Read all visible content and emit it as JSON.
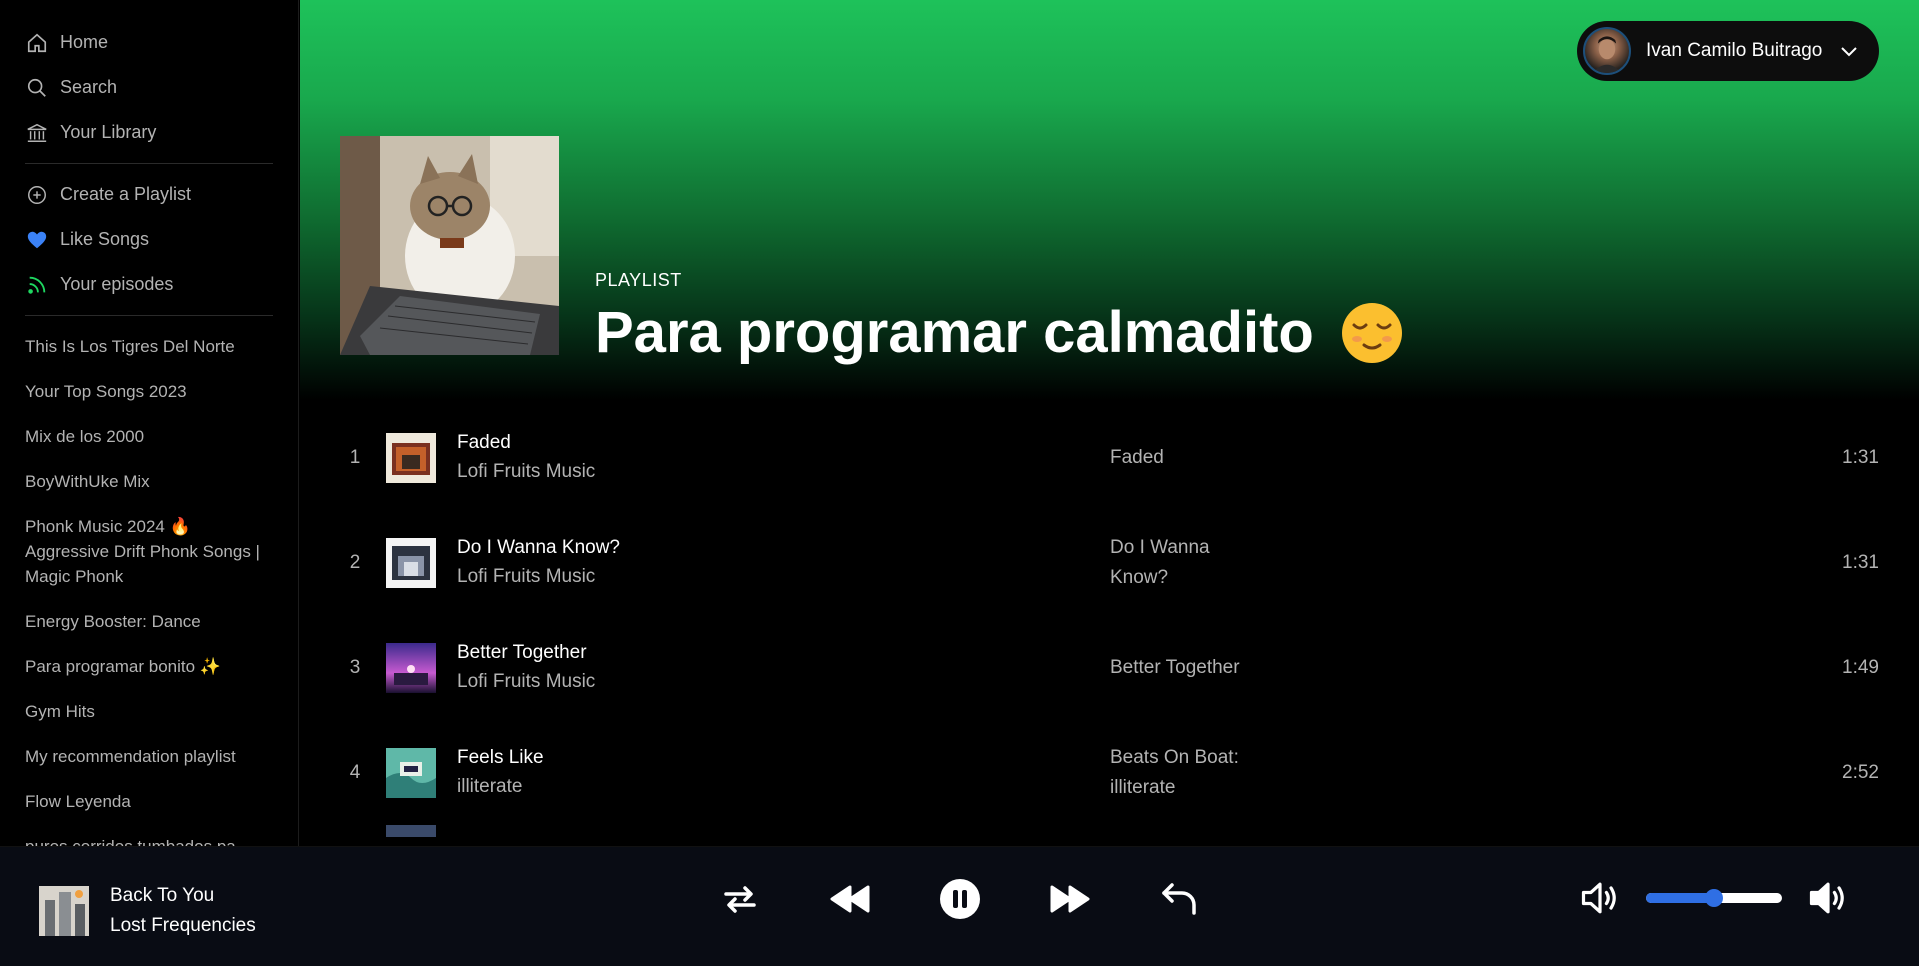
{
  "sidebar": {
    "nav": [
      {
        "label": "Home",
        "icon": "home-icon"
      },
      {
        "label": "Search",
        "icon": "search-icon"
      },
      {
        "label": "Your Library",
        "icon": "library-icon"
      }
    ],
    "actions": [
      {
        "label": "Create a Playlist",
        "icon": "plus-circle-icon"
      },
      {
        "label": "Like Songs",
        "icon": "heart-icon"
      },
      {
        "label": "Your episodes",
        "icon": "rss-icon"
      }
    ],
    "playlists": [
      "This Is Los Tigres Del Norte",
      "Your Top Songs 2023",
      "Mix de los 2000",
      "BoyWithUke Mix",
      "Phonk Music 2024 🔥 Aggressive Drift Phonk Songs | Magic Phonk",
      "Energy Booster: Dance",
      "Para programar bonito ✨",
      "Gym Hits",
      "My recommendation playlist",
      "Flow Leyenda",
      "puros corridos tumbados pa"
    ]
  },
  "user": {
    "name": "Ivan Camilo Buitrago"
  },
  "playlist": {
    "type": "PLAYLIST",
    "title": "Para programar calmadito",
    "title_emoji": "😌"
  },
  "tracks": [
    {
      "num": "1",
      "title": "Faded",
      "artist": "Lofi Fruits Music",
      "album": "Faded",
      "duration": "1:31"
    },
    {
      "num": "2",
      "title": "Do I Wanna Know?",
      "artist": "Lofi Fruits Music",
      "album": "Do I Wanna Know?",
      "duration": "1:31"
    },
    {
      "num": "3",
      "title": "Better Together",
      "artist": "Lofi Fruits Music",
      "album": "Better Together",
      "duration": "1:49"
    },
    {
      "num": "4",
      "title": "Feels Like",
      "artist": "illiterate",
      "album": "Beats On Boat: illiterate",
      "duration": "2:52"
    }
  ],
  "player": {
    "now_title": "Back To You",
    "now_artist": "Lost Frequencies",
    "volume": 0.5,
    "colors": {
      "accent": "#2f6fe4",
      "brand": "#1ed760"
    }
  }
}
